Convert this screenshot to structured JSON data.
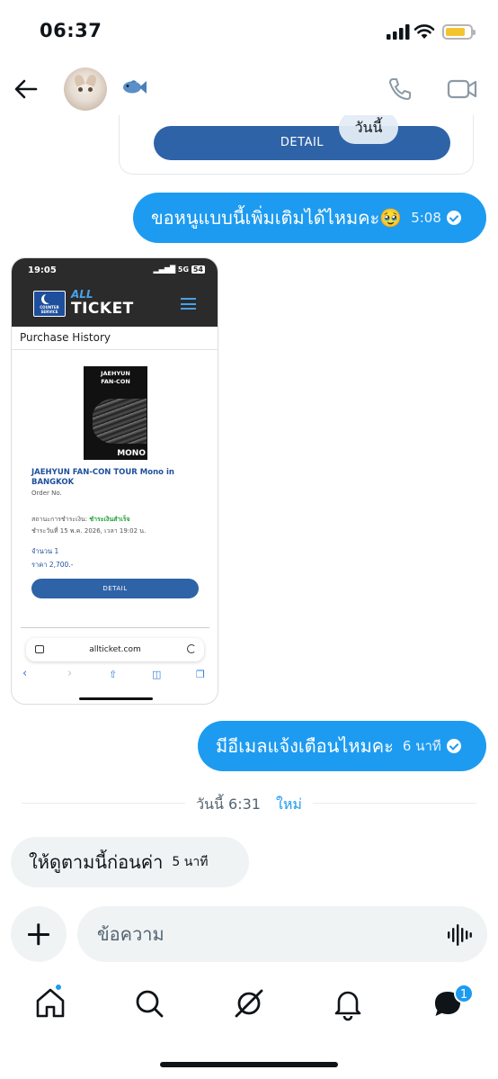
{
  "status_bar": {
    "time": "06:37"
  },
  "header": {
    "back": "back-arrow-icon",
    "avatar": "cat-avatar",
    "name_emoji": "fish-icon",
    "call": "phone-icon",
    "video": "video-camera-icon"
  },
  "chat": {
    "card_button_label": "DETAIL",
    "day_pill": "วันนี้",
    "msg1": {
      "text": "ขอหนูแบบนี้เพิ่มเติมได้ไหมคะ🥹",
      "time": "5:08"
    },
    "image": {
      "time": "19:05",
      "status": "5G",
      "battery": "54",
      "brand_all": "ALL",
      "brand_ticket": "TICKET",
      "logo_text": "COUNTER SERVICE",
      "page_title": "Purchase History",
      "poster_title": "JAEHYUN FAN-CON",
      "poster_mono": "MONO",
      "event_name": "JAEHYUN FAN-CON TOUR Mono in BANGKOK",
      "order_no": "Order No.",
      "pay_status_label": "สถานะการชำระเงิน:",
      "pay_status_value": "ชำระเงินสำเร็จ",
      "pay_date": "ชำระวันที่ 15 พ.ค. 2026, เวลา 19:02 น.",
      "qty": "จำนวน 1",
      "price": "ราคา 2,700.-",
      "detail_label": "DETAIL",
      "url": "allticket.com"
    },
    "msg2": {
      "text": "มีอีเมลแจ้งเตือนไหมคะ",
      "time": "6 นาที"
    },
    "separator": {
      "time": "วันนี้ 6:31",
      "new": "ใหม่"
    },
    "msg3": {
      "text": "ให้ดูตามนี้ก่อนค่า",
      "time": "5 นาที"
    }
  },
  "composer": {
    "placeholder": "ข้อความ"
  },
  "nav": {
    "badge": "1",
    "accent": "#1d9bf0"
  }
}
